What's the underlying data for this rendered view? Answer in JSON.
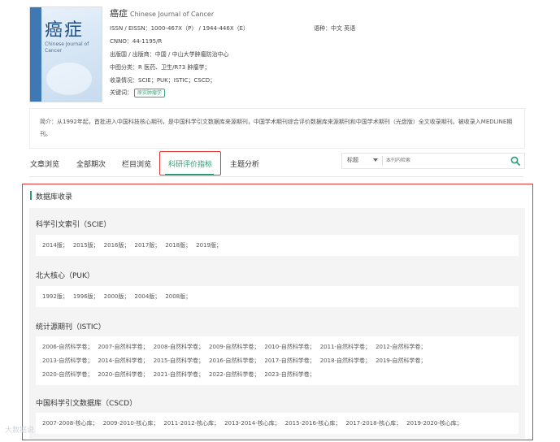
{
  "journal": {
    "cover_title": "癌症",
    "cover_en": "Chinese Journal of Cancer",
    "title_cn": "癌症",
    "title_en": "Chinese Journal of Cancer",
    "issn": "ISSN / EISSN：1000-467X（P） / 1944-446X（E）",
    "cnno": "CNNO：44-1195/R",
    "publisher": "出版国 / 出版商：中国 / 中山大学肿瘤防治中心",
    "classification": "中图分类：R 医药、卫生/R73 肿瘤学；",
    "indexed": "收录情况：SCIE；PUK；ISTIC；CSCD；",
    "keywords_label": "关键词：",
    "keyword_tag": "原实肿瘤学",
    "language": "语种：中文  英语",
    "intro": "简介：从1992年起，首批进入中国科技核心期刊，是中国科学引文数据库来源期刊，中国学术期刊综合评价数据库来源期刊和中国学术期刊（光盘版）全文收录期刊。被收录入MEDLINE期刊。"
  },
  "tabs": [
    {
      "label": "文章浏览"
    },
    {
      "label": "全部期次"
    },
    {
      "label": "栏目浏览"
    },
    {
      "label": "科研评价指标"
    },
    {
      "label": "主题分析"
    }
  ],
  "search": {
    "field": "标题",
    "placeholder": "本刊内检索"
  },
  "section_title": "数据库收录",
  "groups": [
    {
      "title": "科学引文索引（SCIE）",
      "rows": [
        [
          "2014版；",
          "2015版；",
          "2016版；",
          "2017版；",
          "2018版；",
          "2019版；"
        ]
      ]
    },
    {
      "title": "北大核心（PUK）",
      "rows": [
        [
          "1992版；",
          "1996版；",
          "2000版；",
          "2004版；",
          "2008版；"
        ]
      ]
    },
    {
      "title": "统计源期刊（ISTIC）",
      "rows": [
        [
          "2006-自然科学卷；",
          "2007-自然科学卷；",
          "2008-自然科学卷；",
          "2009-自然科学卷；",
          "2010-自然科学卷；",
          "2011-自然科学卷；",
          "2012-自然科学卷；"
        ],
        [
          "2013-自然科学卷；",
          "2014-自然科学卷；",
          "2015-自然科学卷；",
          "2016-自然科学卷；",
          "2017-自然科学卷；",
          "2018-自然科学卷；",
          "2019-自然科学卷；"
        ],
        [
          "2020-自然科学卷；",
          "2020-自然科学卷；",
          "2021-自然科学卷；",
          "2022-自然科学卷；",
          "2023-自然科学卷；"
        ]
      ]
    },
    {
      "title": "中国科学引文数据库（CSCD）",
      "rows": [
        [
          "2007-2008-核心库；",
          "2009-2010-核心库；",
          "2011-2012-核心库；",
          "2013-2014-核心库；",
          "2015-2016-核心库；",
          "2017-2018-核心库；",
          "2019-2020-核心库；"
        ]
      ]
    }
  ],
  "watermark": "大数据说",
  "colors": {
    "accent": "#2e9b74",
    "highlight": "#e53935"
  }
}
